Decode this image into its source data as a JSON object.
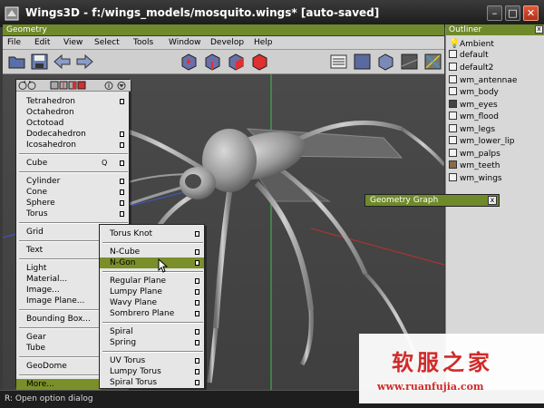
{
  "window": {
    "title": "Wings3D - f:/wings_models/mosquito.wings* [auto-saved]",
    "minimize_icon": "minimize-icon",
    "maximize_icon": "maximize-icon",
    "close_icon": "close-icon"
  },
  "geometry": {
    "header": "Geometry",
    "menus": [
      "File",
      "Edit",
      "View",
      "Select",
      "Tools",
      "Window",
      "Develop",
      "Help"
    ]
  },
  "toolbar": {
    "left_icons": [
      "open-folder-icon",
      "save-icon",
      "undo-arrow-icon",
      "redo-arrow-icon"
    ],
    "select_mode_icons": [
      "vertex-mode-icon",
      "edge-mode-icon",
      "face-mode-icon",
      "body-mode-icon"
    ],
    "view_icons": [
      "groundplane-icon",
      "smooth-shade-icon",
      "wireframe-icon",
      "axes-icon",
      "perspective-icon"
    ]
  },
  "primary_menu": {
    "items": [
      {
        "label": "Tetrahedron",
        "option": true
      },
      {
        "label": "Octahedron",
        "option": false
      },
      {
        "label": "Octotoad",
        "option": false
      },
      {
        "label": "Dodecahedron",
        "option": true
      },
      {
        "label": "Icosahedron",
        "option": true
      },
      {
        "separator": true
      },
      {
        "label": "Cube",
        "shortcut": "Q",
        "option": true
      },
      {
        "separator": true
      },
      {
        "label": "Cylinder",
        "option": true
      },
      {
        "label": "Cone",
        "option": true
      },
      {
        "label": "Sphere",
        "option": true
      },
      {
        "label": "Torus",
        "option": true
      },
      {
        "separator": true
      },
      {
        "label": "Grid",
        "option": false
      },
      {
        "separator": true
      },
      {
        "label": "Text",
        "option": false
      },
      {
        "separator": true
      },
      {
        "label": "Light",
        "option": false
      },
      {
        "label": "Material...",
        "option": false
      },
      {
        "label": "Image...",
        "option": false
      },
      {
        "label": "Image Plane...",
        "option": false
      },
      {
        "separator": true
      },
      {
        "label": "Bounding Box...",
        "option": false
      },
      {
        "separator": true
      },
      {
        "label": "Gear",
        "option": false
      },
      {
        "label": "Tube",
        "option": false
      },
      {
        "separator": true
      },
      {
        "label": "GeoDome",
        "option": false
      },
      {
        "separator": true
      },
      {
        "label": "More...",
        "option": false,
        "highlighted": true
      }
    ]
  },
  "sub_menu": {
    "items": [
      {
        "label": "Torus Knot",
        "option": true
      },
      {
        "separator": true
      },
      {
        "label": "N-Cube",
        "option": true
      },
      {
        "label": "N-Gon",
        "option": true,
        "highlighted": true
      },
      {
        "separator": true
      },
      {
        "label": "Regular Plane",
        "option": true
      },
      {
        "label": "Lumpy Plane",
        "option": true
      },
      {
        "label": "Wavy Plane",
        "option": true
      },
      {
        "label": "Sombrero Plane",
        "option": true
      },
      {
        "separator": true
      },
      {
        "label": "Spiral",
        "option": true
      },
      {
        "label": "Spring",
        "option": true
      },
      {
        "separator": true
      },
      {
        "label": "UV Torus",
        "option": true
      },
      {
        "label": "Lumpy Torus",
        "option": true
      },
      {
        "label": "Spiral Torus",
        "option": true
      }
    ]
  },
  "outliner": {
    "header": "Outliner",
    "close_label": "x",
    "items": [
      {
        "label": "Ambient",
        "icon": "lightbulb-icon"
      },
      {
        "label": "default",
        "icon": "material-icon"
      },
      {
        "label": "default2",
        "icon": "material-icon"
      },
      {
        "label": "wm_antennae",
        "icon": "material-icon"
      },
      {
        "label": "wm_body",
        "icon": "material-icon"
      },
      {
        "label": "wm_eyes",
        "icon": "material-dark-icon"
      },
      {
        "label": "wm_flood",
        "icon": "material-icon"
      },
      {
        "label": "wm_legs",
        "icon": "material-icon"
      },
      {
        "label": "wm_lower_lip",
        "icon": "material-icon"
      },
      {
        "label": "wm_palps",
        "icon": "material-icon"
      },
      {
        "label": "wm_teeth",
        "icon": "material-brown-icon"
      },
      {
        "label": "wm_wings",
        "icon": "material-icon"
      }
    ]
  },
  "geometry_graph": {
    "title": "Geometry Graph",
    "close_label": "x"
  },
  "status": {
    "text": "R: Open option dialog"
  },
  "watermark": {
    "cn": "软服之家",
    "url": "www.ruanfujia.com"
  },
  "colors": {
    "accent": "#6f8a2a",
    "highlight": "#7a8f2a",
    "menu_bg": "#e6e6e6",
    "title_bg": "#1a1a1a"
  }
}
